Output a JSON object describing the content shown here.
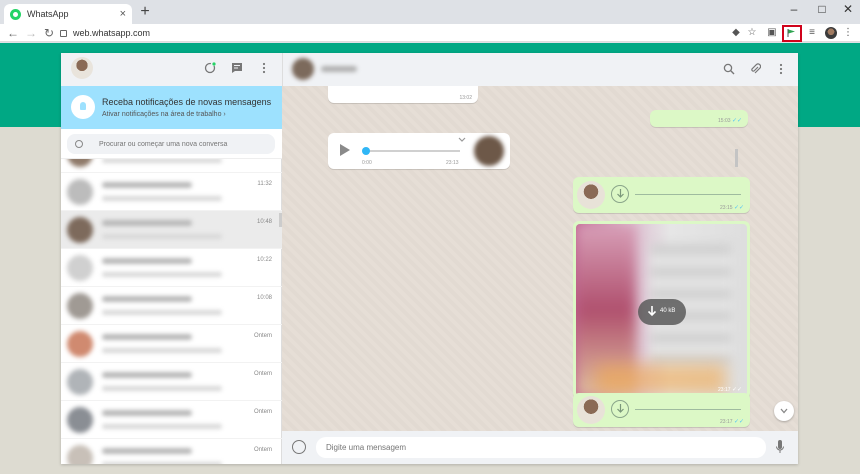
{
  "browser": {
    "tab_title": "WhatsApp",
    "tab_close": "×",
    "new_tab": "+",
    "url": "web.whatsapp.com",
    "win_minimize": "–",
    "win_maximize": "□",
    "win_close": "✕"
  },
  "notification": {
    "title": "Receba notificações de novas mensagens",
    "action": "Ativar notificações na área de trabalho"
  },
  "search": {
    "placeholder": "Procurar ou começar uma nova conversa"
  },
  "chats": [
    {
      "time": ""
    },
    {
      "time": "11:32"
    },
    {
      "time": "10:48",
      "selected": true
    },
    {
      "time": "10:22"
    },
    {
      "time": "10:08"
    },
    {
      "time": "Ontem"
    },
    {
      "time": "Ontem"
    },
    {
      "time": "Ontem"
    },
    {
      "time": "Ontem"
    }
  ],
  "messages": {
    "m1_time": "13:02",
    "m2_time": "15:03",
    "audio_in_start": "0:00",
    "audio_in_time": "23:13",
    "audio_out1_time": "23:15",
    "image_size": "40 kB",
    "image_time": "23:17",
    "audio_out2_time": "23:17"
  },
  "composer": {
    "placeholder": "Digite uma mensagem"
  },
  "colors": {
    "brand_band": "#00a884",
    "out_bubble": "#dcf8c6",
    "notification_bg": "#9de1fe",
    "highlight": "#d0021b"
  }
}
